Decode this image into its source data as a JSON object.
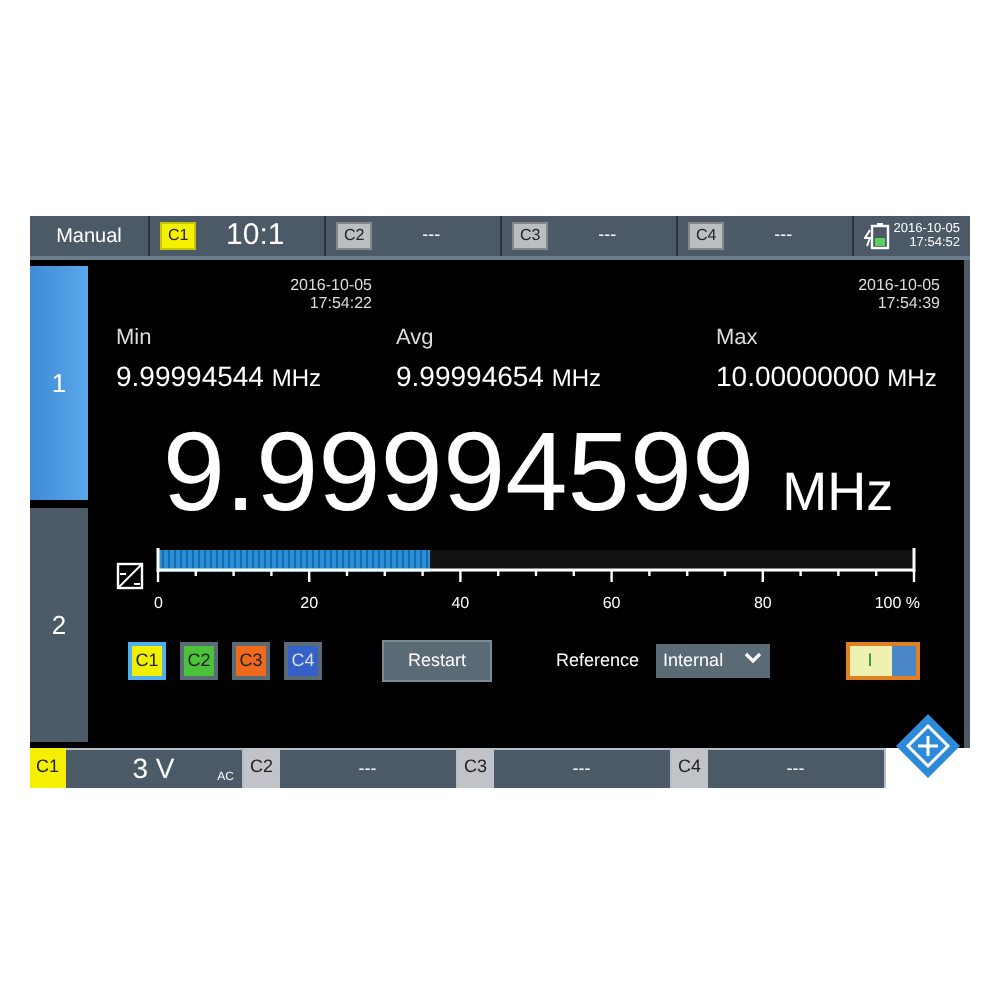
{
  "top_bar": {
    "mode": "Manual",
    "channels": [
      {
        "label": "C1",
        "value": "10:1",
        "active": true
      },
      {
        "label": "C2",
        "value": "---",
        "active": false
      },
      {
        "label": "C3",
        "value": "---",
        "active": false
      },
      {
        "label": "C4",
        "value": "---",
        "active": false
      }
    ],
    "date": "2016-10-05",
    "time": "17:54:52"
  },
  "side_tabs": [
    {
      "label": "1",
      "selected": true
    },
    {
      "label": "2",
      "selected": false
    }
  ],
  "stats": [
    {
      "label": "Min",
      "date": "2016-10-05",
      "time": "17:54:22",
      "value": "9.99994544",
      "unit": "MHz"
    },
    {
      "label": "Avg",
      "value": "9.99994654",
      "unit": "MHz"
    },
    {
      "label": "Max",
      "date": "2016-10-05",
      "time": "17:54:39",
      "value": "10.00000000",
      "unit": "MHz"
    }
  ],
  "reading": {
    "value": "9.99994599",
    "unit": "MHz"
  },
  "progress": {
    "level": 0.36,
    "ticks": [
      "0",
      "20",
      "40",
      "60",
      "80",
      "100 %"
    ]
  },
  "sources": [
    {
      "label": "C1",
      "color": "#f2f000",
      "selected": true
    },
    {
      "label": "C2",
      "color": "#4cc23a",
      "selected": false
    },
    {
      "label": "C3",
      "color": "#f06a1e",
      "selected": false
    },
    {
      "label": "C4",
      "color": "#3460c8",
      "selected": false
    }
  ],
  "restart": "Restart",
  "reference": {
    "label": "Reference",
    "value": "Internal"
  },
  "switch": {
    "label": "I",
    "on": true
  },
  "bottom_bar": [
    {
      "label": "C1",
      "value": "3 V",
      "coupling": "AC",
      "active": true
    },
    {
      "label": "C2",
      "value": "---",
      "active": false
    },
    {
      "label": "C3",
      "value": "---",
      "active": false
    },
    {
      "label": "C4",
      "value": "---",
      "active": false
    }
  ]
}
